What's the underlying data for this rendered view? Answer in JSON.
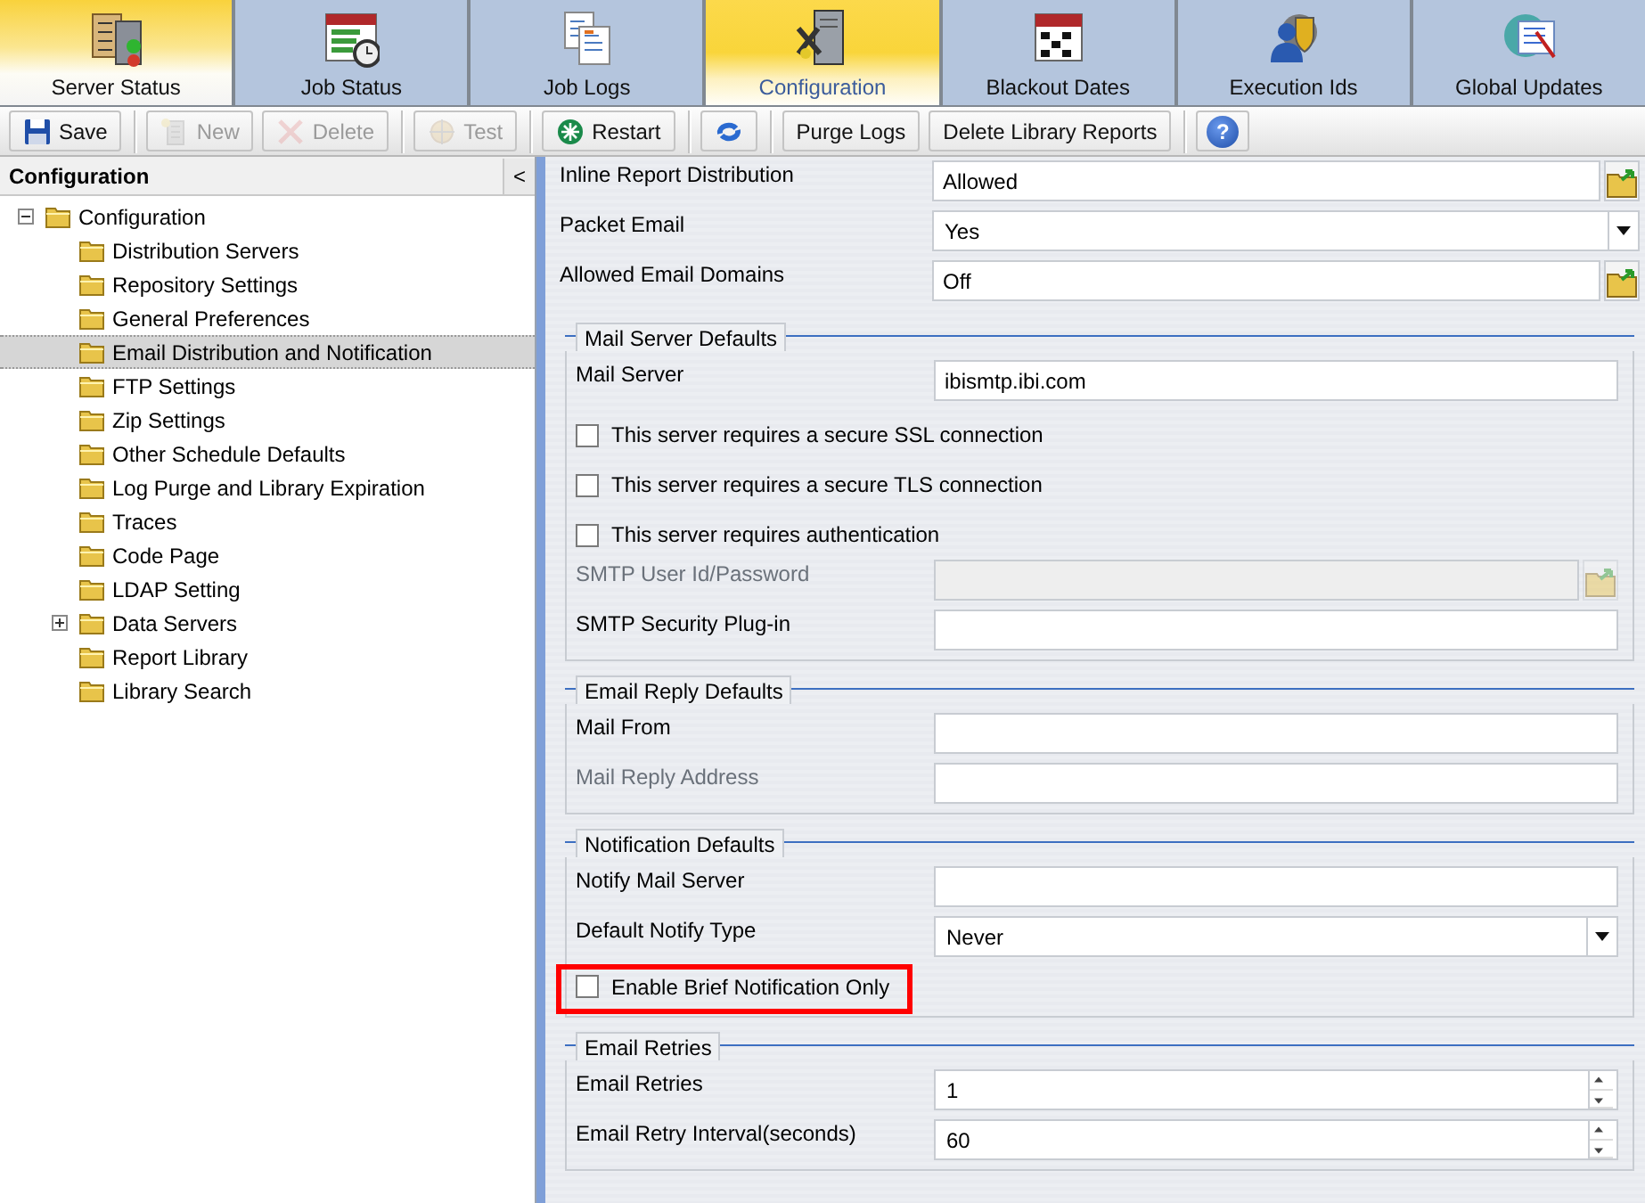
{
  "tabs": [
    {
      "label": "Server Status",
      "selected": false,
      "highlighted": true
    },
    {
      "label": "Job Status",
      "selected": false,
      "highlighted": false
    },
    {
      "label": "Job Logs",
      "selected": false,
      "highlighted": false
    },
    {
      "label": "Configuration",
      "selected": true,
      "highlighted": false
    },
    {
      "label": "Blackout Dates",
      "selected": false,
      "highlighted": false
    },
    {
      "label": "Execution Ids",
      "selected": false,
      "highlighted": false
    },
    {
      "label": "Global Updates",
      "selected": false,
      "highlighted": false
    }
  ],
  "toolbar": {
    "groups": [
      [
        {
          "kind": "icon-text",
          "label": "Save",
          "disabled": false
        }
      ],
      [
        {
          "kind": "icon-text",
          "label": "New",
          "disabled": true
        },
        {
          "kind": "icon-text",
          "label": "Delete",
          "disabled": true
        }
      ],
      [
        {
          "kind": "icon-text",
          "label": "Test",
          "disabled": true
        }
      ],
      [
        {
          "kind": "icon-text",
          "label": "Restart",
          "disabled": false
        }
      ],
      [
        {
          "kind": "icon",
          "disabled": false
        }
      ],
      [
        {
          "kind": "text",
          "label": "Purge Logs",
          "disabled": false
        },
        {
          "kind": "text",
          "label": "Delete Library Reports",
          "disabled": false
        }
      ],
      [
        {
          "kind": "badge",
          "label": "?",
          "disabled": false
        }
      ]
    ]
  },
  "sidebar": {
    "title": "Configuration",
    "collapse_label": "<",
    "tree": [
      {
        "label": "Configuration",
        "expanded": true,
        "selected": false,
        "children": [
          {
            "label": "Distribution Servers",
            "selected": false
          },
          {
            "label": "Repository Settings",
            "selected": false
          },
          {
            "label": "General Preferences",
            "selected": false
          },
          {
            "label": "Email Distribution and Notification",
            "selected": true
          },
          {
            "label": "FTP Settings",
            "selected": false
          },
          {
            "label": "Zip Settings",
            "selected": false
          },
          {
            "label": "Other Schedule Defaults",
            "selected": false
          },
          {
            "label": "Log Purge and Library Expiration",
            "selected": false
          },
          {
            "label": "Traces",
            "selected": false
          },
          {
            "label": "Code Page",
            "selected": false
          },
          {
            "label": "LDAP Setting",
            "selected": false
          },
          {
            "label": "Data Servers",
            "expanded": false,
            "selected": false
          },
          {
            "label": "Report Library",
            "selected": false
          },
          {
            "label": "Library Search",
            "selected": false
          }
        ]
      }
    ]
  },
  "form": {
    "fields": [
      {
        "kind": "picker",
        "label": "Inline Report Distribution",
        "value": "Allowed",
        "disabled": false
      },
      {
        "kind": "select",
        "label": "Packet Email",
        "value": "Yes"
      },
      {
        "kind": "picker",
        "label": "Allowed Email Domains",
        "value": "Off",
        "disabled": false
      }
    ],
    "sections": [
      {
        "title": "Mail Server Defaults",
        "rows": [
          {
            "kind": "text",
            "label": "Mail Server",
            "value": "ibismtp.ibi.com",
            "disabled": false
          },
          {
            "kind": "checkbox",
            "label": "This server requires a secure SSL connection",
            "checked": false,
            "highlighted": false
          },
          {
            "kind": "checkbox",
            "label": "This server requires a secure TLS connection",
            "checked": false,
            "highlighted": false
          },
          {
            "kind": "checkbox",
            "label": "This server requires authentication",
            "checked": false,
            "highlighted": false
          },
          {
            "kind": "picker",
            "label": "SMTP User Id/Password",
            "disabled": true
          },
          {
            "kind": "text",
            "label": "SMTP Security Plug-in",
            "disabled": false
          }
        ]
      },
      {
        "title": "Email Reply Defaults",
        "rows": [
          {
            "kind": "text",
            "label": "Mail From",
            "disabled": false
          },
          {
            "kind": "text",
            "label": "Mail Reply Address",
            "disabled": true
          }
        ]
      },
      {
        "title": "Notification Defaults",
        "rows": [
          {
            "kind": "text",
            "label": "Notify Mail Server",
            "disabled": false
          },
          {
            "kind": "select",
            "label": "Default Notify Type",
            "value": "Never"
          },
          {
            "kind": "checkbox",
            "label": "Enable Brief Notification Only",
            "checked": false,
            "highlighted": true
          }
        ]
      },
      {
        "title": "Email Retries",
        "rows": [
          {
            "kind": "spinner",
            "label": "Email Retries",
            "value": "1"
          },
          {
            "kind": "spinner",
            "label": "Email Retry Interval(seconds)",
            "value": "60"
          }
        ]
      }
    ]
  }
}
